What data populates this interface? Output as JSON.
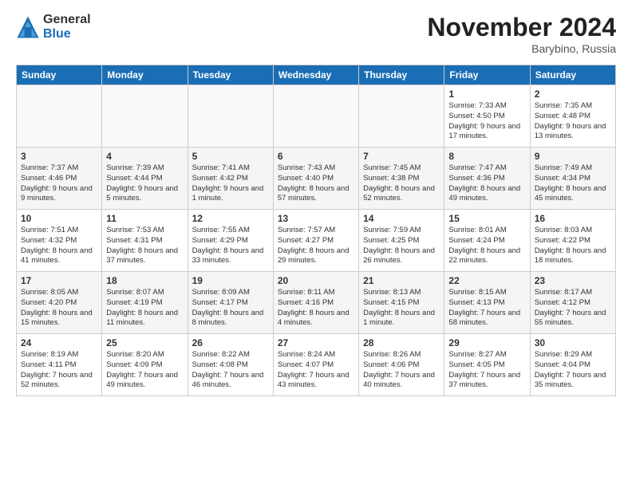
{
  "logo": {
    "general": "General",
    "blue": "Blue"
  },
  "title": "November 2024",
  "location": "Barybino, Russia",
  "headers": [
    "Sunday",
    "Monday",
    "Tuesday",
    "Wednesday",
    "Thursday",
    "Friday",
    "Saturday"
  ],
  "weeks": [
    [
      {
        "day": "",
        "info": ""
      },
      {
        "day": "",
        "info": ""
      },
      {
        "day": "",
        "info": ""
      },
      {
        "day": "",
        "info": ""
      },
      {
        "day": "",
        "info": ""
      },
      {
        "day": "1",
        "info": "Sunrise: 7:33 AM\nSunset: 4:50 PM\nDaylight: 9 hours and 17 minutes."
      },
      {
        "day": "2",
        "info": "Sunrise: 7:35 AM\nSunset: 4:48 PM\nDaylight: 9 hours and 13 minutes."
      }
    ],
    [
      {
        "day": "3",
        "info": "Sunrise: 7:37 AM\nSunset: 4:46 PM\nDaylight: 9 hours and 9 minutes."
      },
      {
        "day": "4",
        "info": "Sunrise: 7:39 AM\nSunset: 4:44 PM\nDaylight: 9 hours and 5 minutes."
      },
      {
        "day": "5",
        "info": "Sunrise: 7:41 AM\nSunset: 4:42 PM\nDaylight: 9 hours and 1 minute."
      },
      {
        "day": "6",
        "info": "Sunrise: 7:43 AM\nSunset: 4:40 PM\nDaylight: 8 hours and 57 minutes."
      },
      {
        "day": "7",
        "info": "Sunrise: 7:45 AM\nSunset: 4:38 PM\nDaylight: 8 hours and 52 minutes."
      },
      {
        "day": "8",
        "info": "Sunrise: 7:47 AM\nSunset: 4:36 PM\nDaylight: 8 hours and 49 minutes."
      },
      {
        "day": "9",
        "info": "Sunrise: 7:49 AM\nSunset: 4:34 PM\nDaylight: 8 hours and 45 minutes."
      }
    ],
    [
      {
        "day": "10",
        "info": "Sunrise: 7:51 AM\nSunset: 4:32 PM\nDaylight: 8 hours and 41 minutes."
      },
      {
        "day": "11",
        "info": "Sunrise: 7:53 AM\nSunset: 4:31 PM\nDaylight: 8 hours and 37 minutes."
      },
      {
        "day": "12",
        "info": "Sunrise: 7:55 AM\nSunset: 4:29 PM\nDaylight: 8 hours and 33 minutes."
      },
      {
        "day": "13",
        "info": "Sunrise: 7:57 AM\nSunset: 4:27 PM\nDaylight: 8 hours and 29 minutes."
      },
      {
        "day": "14",
        "info": "Sunrise: 7:59 AM\nSunset: 4:25 PM\nDaylight: 8 hours and 26 minutes."
      },
      {
        "day": "15",
        "info": "Sunrise: 8:01 AM\nSunset: 4:24 PM\nDaylight: 8 hours and 22 minutes."
      },
      {
        "day": "16",
        "info": "Sunrise: 8:03 AM\nSunset: 4:22 PM\nDaylight: 8 hours and 18 minutes."
      }
    ],
    [
      {
        "day": "17",
        "info": "Sunrise: 8:05 AM\nSunset: 4:20 PM\nDaylight: 8 hours and 15 minutes."
      },
      {
        "day": "18",
        "info": "Sunrise: 8:07 AM\nSunset: 4:19 PM\nDaylight: 8 hours and 11 minutes."
      },
      {
        "day": "19",
        "info": "Sunrise: 8:09 AM\nSunset: 4:17 PM\nDaylight: 8 hours and 8 minutes."
      },
      {
        "day": "20",
        "info": "Sunrise: 8:11 AM\nSunset: 4:16 PM\nDaylight: 8 hours and 4 minutes."
      },
      {
        "day": "21",
        "info": "Sunrise: 8:13 AM\nSunset: 4:15 PM\nDaylight: 8 hours and 1 minute."
      },
      {
        "day": "22",
        "info": "Sunrise: 8:15 AM\nSunset: 4:13 PM\nDaylight: 7 hours and 58 minutes."
      },
      {
        "day": "23",
        "info": "Sunrise: 8:17 AM\nSunset: 4:12 PM\nDaylight: 7 hours and 55 minutes."
      }
    ],
    [
      {
        "day": "24",
        "info": "Sunrise: 8:19 AM\nSunset: 4:11 PM\nDaylight: 7 hours and 52 minutes."
      },
      {
        "day": "25",
        "info": "Sunrise: 8:20 AM\nSunset: 4:09 PM\nDaylight: 7 hours and 49 minutes."
      },
      {
        "day": "26",
        "info": "Sunrise: 8:22 AM\nSunset: 4:08 PM\nDaylight: 7 hours and 46 minutes."
      },
      {
        "day": "27",
        "info": "Sunrise: 8:24 AM\nSunset: 4:07 PM\nDaylight: 7 hours and 43 minutes."
      },
      {
        "day": "28",
        "info": "Sunrise: 8:26 AM\nSunset: 4:06 PM\nDaylight: 7 hours and 40 minutes."
      },
      {
        "day": "29",
        "info": "Sunrise: 8:27 AM\nSunset: 4:05 PM\nDaylight: 7 hours and 37 minutes."
      },
      {
        "day": "30",
        "info": "Sunrise: 8:29 AM\nSunset: 4:04 PM\nDaylight: 7 hours and 35 minutes."
      }
    ]
  ]
}
